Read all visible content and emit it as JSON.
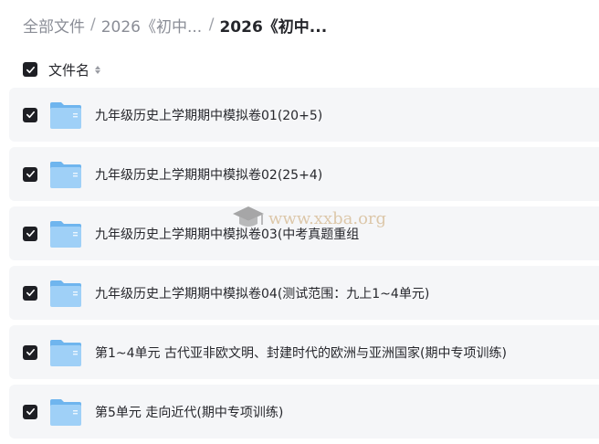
{
  "breadcrumb": {
    "items": [
      "全部文件",
      "2026《初中...",
      "2026《初中..."
    ]
  },
  "header": {
    "column_label": "文件名"
  },
  "files": [
    {
      "name": "九年级历史上学期期中模拟卷01(20+5)"
    },
    {
      "name": "九年级历史上学期期中模拟卷02(25+4)"
    },
    {
      "name": "九年级历史上学期期中模拟卷03(中考真题重组"
    },
    {
      "name": "九年级历史上学期期中模拟卷04(测试范围：九上1~4单元)"
    },
    {
      "name": "第1~4单元 古代亚非欧文明、封建时代的欧洲与亚洲国家(期中专项训练)"
    },
    {
      "name": "第5单元 走向近代(期中专项训练)"
    }
  ],
  "watermark": {
    "text": "www.xxba.org"
  },
  "colors": {
    "folder_light": "#9fd0f7",
    "folder_dark": "#6fb5ee",
    "checkbox": "#1e1f24",
    "row_bg": "#f5f6f8"
  }
}
